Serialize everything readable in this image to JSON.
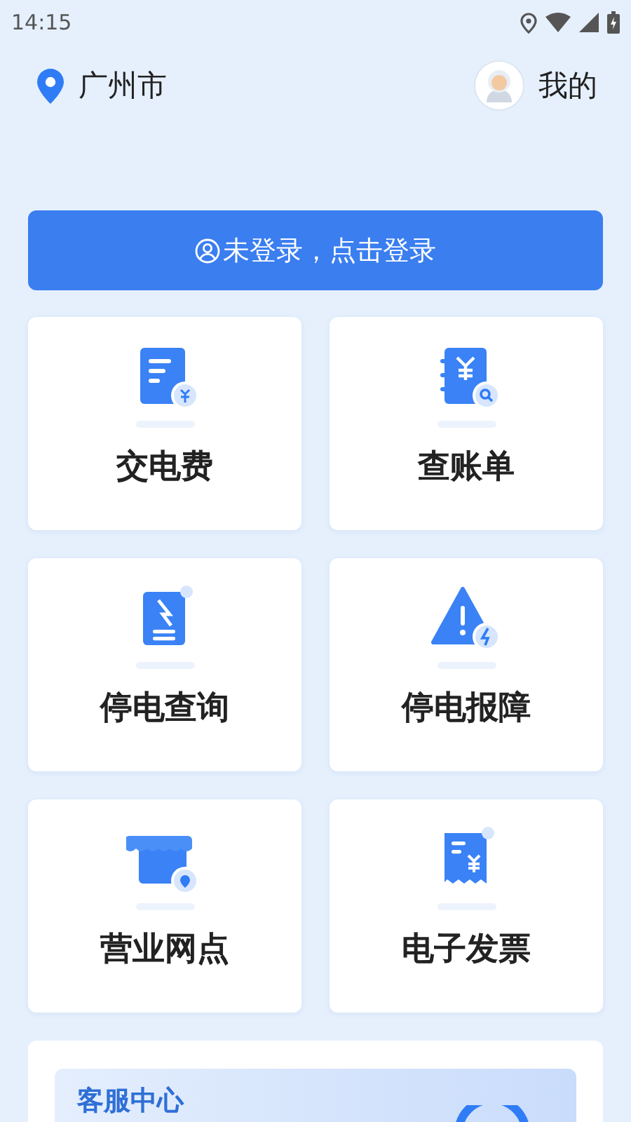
{
  "status_bar": {
    "time": "14:15"
  },
  "header": {
    "city": "广州市",
    "profile": "我的"
  },
  "login_button": {
    "label": "未登录，点击登录"
  },
  "tiles": [
    {
      "kind": "bill",
      "label": "交电费"
    },
    {
      "kind": "account",
      "label": "查账单"
    },
    {
      "kind": "outage",
      "label": "停电查询"
    },
    {
      "kind": "fault",
      "label": "停电报障"
    },
    {
      "kind": "outlet",
      "label": "营业网点"
    },
    {
      "kind": "invoice",
      "label": "电子发票"
    }
  ],
  "service": {
    "title": "客服中心"
  }
}
